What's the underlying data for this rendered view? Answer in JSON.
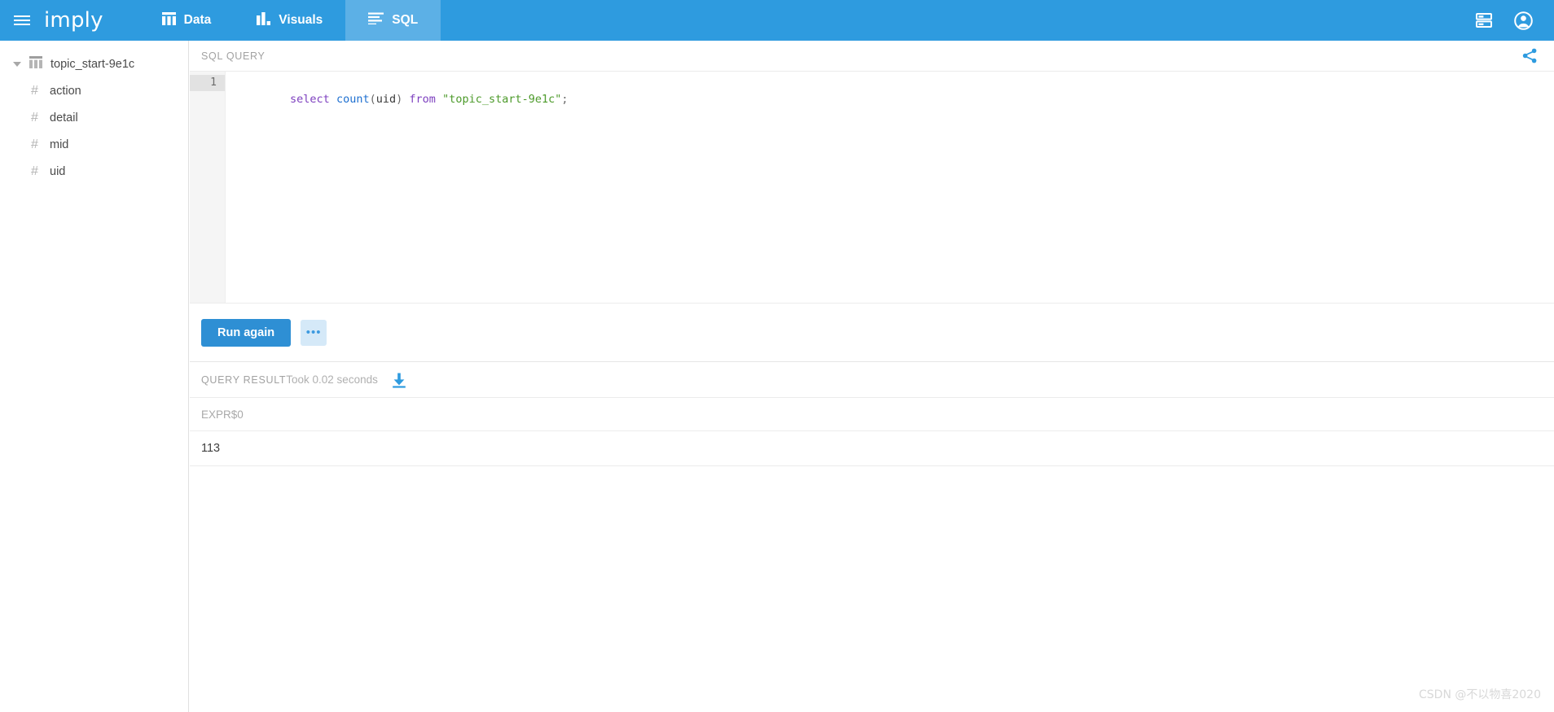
{
  "header": {
    "menu_icon": "hamburger-icon",
    "brand": "imply",
    "nav": [
      {
        "label": "Data",
        "icon": "table-icon",
        "active": false
      },
      {
        "label": "Visuals",
        "icon": "bar-chart-icon",
        "active": false
      },
      {
        "label": "SQL",
        "icon": "sql-lines-icon",
        "active": true
      }
    ],
    "right_icons": [
      {
        "name": "servers-icon"
      },
      {
        "name": "account-icon"
      }
    ],
    "background": "#2e9bdf",
    "active_background": "#5cb0e6"
  },
  "sidebar": {
    "datasource": {
      "label": "topic_start-9e1c",
      "icon": "table-icon",
      "expanded": true,
      "caret": "caret-down-icon"
    },
    "columns": [
      {
        "label": "action",
        "icon": "hash-icon",
        "glyph": "#"
      },
      {
        "label": "detail",
        "icon": "hash-icon",
        "glyph": "#"
      },
      {
        "label": "mid",
        "icon": "hash-icon",
        "glyph": "#"
      },
      {
        "label": "uid",
        "icon": "hash-icon",
        "glyph": "#"
      }
    ]
  },
  "query_panel": {
    "title": "SQL QUERY",
    "share_icon": "share-icon",
    "line_number": "1",
    "query_text": "select count(uid) from \"topic_start-9e1c\";",
    "tokens": [
      {
        "text": "select",
        "type": "kw"
      },
      {
        "text": " ",
        "type": "pun"
      },
      {
        "text": "count",
        "type": "fn"
      },
      {
        "text": "(",
        "type": "pun"
      },
      {
        "text": "uid",
        "type": "id"
      },
      {
        "text": ")",
        "type": "pun"
      },
      {
        "text": " ",
        "type": "pun"
      },
      {
        "text": "from",
        "type": "kw"
      },
      {
        "text": " ",
        "type": "pun"
      },
      {
        "text": "\"topic_start-9e1c\"",
        "type": "str"
      },
      {
        "text": ";",
        "type": "pun"
      }
    ],
    "run_label": "Run again",
    "more_label": "•••",
    "run_color": "#2e8fd4"
  },
  "result_panel": {
    "title": "QUERY RESULT",
    "timing": "Took 0.02 seconds",
    "download_icon": "download-icon",
    "columns": [
      "EXPR$0"
    ],
    "rows": [
      [
        "113"
      ]
    ]
  },
  "watermark": "CSDN @不以物喜2020"
}
